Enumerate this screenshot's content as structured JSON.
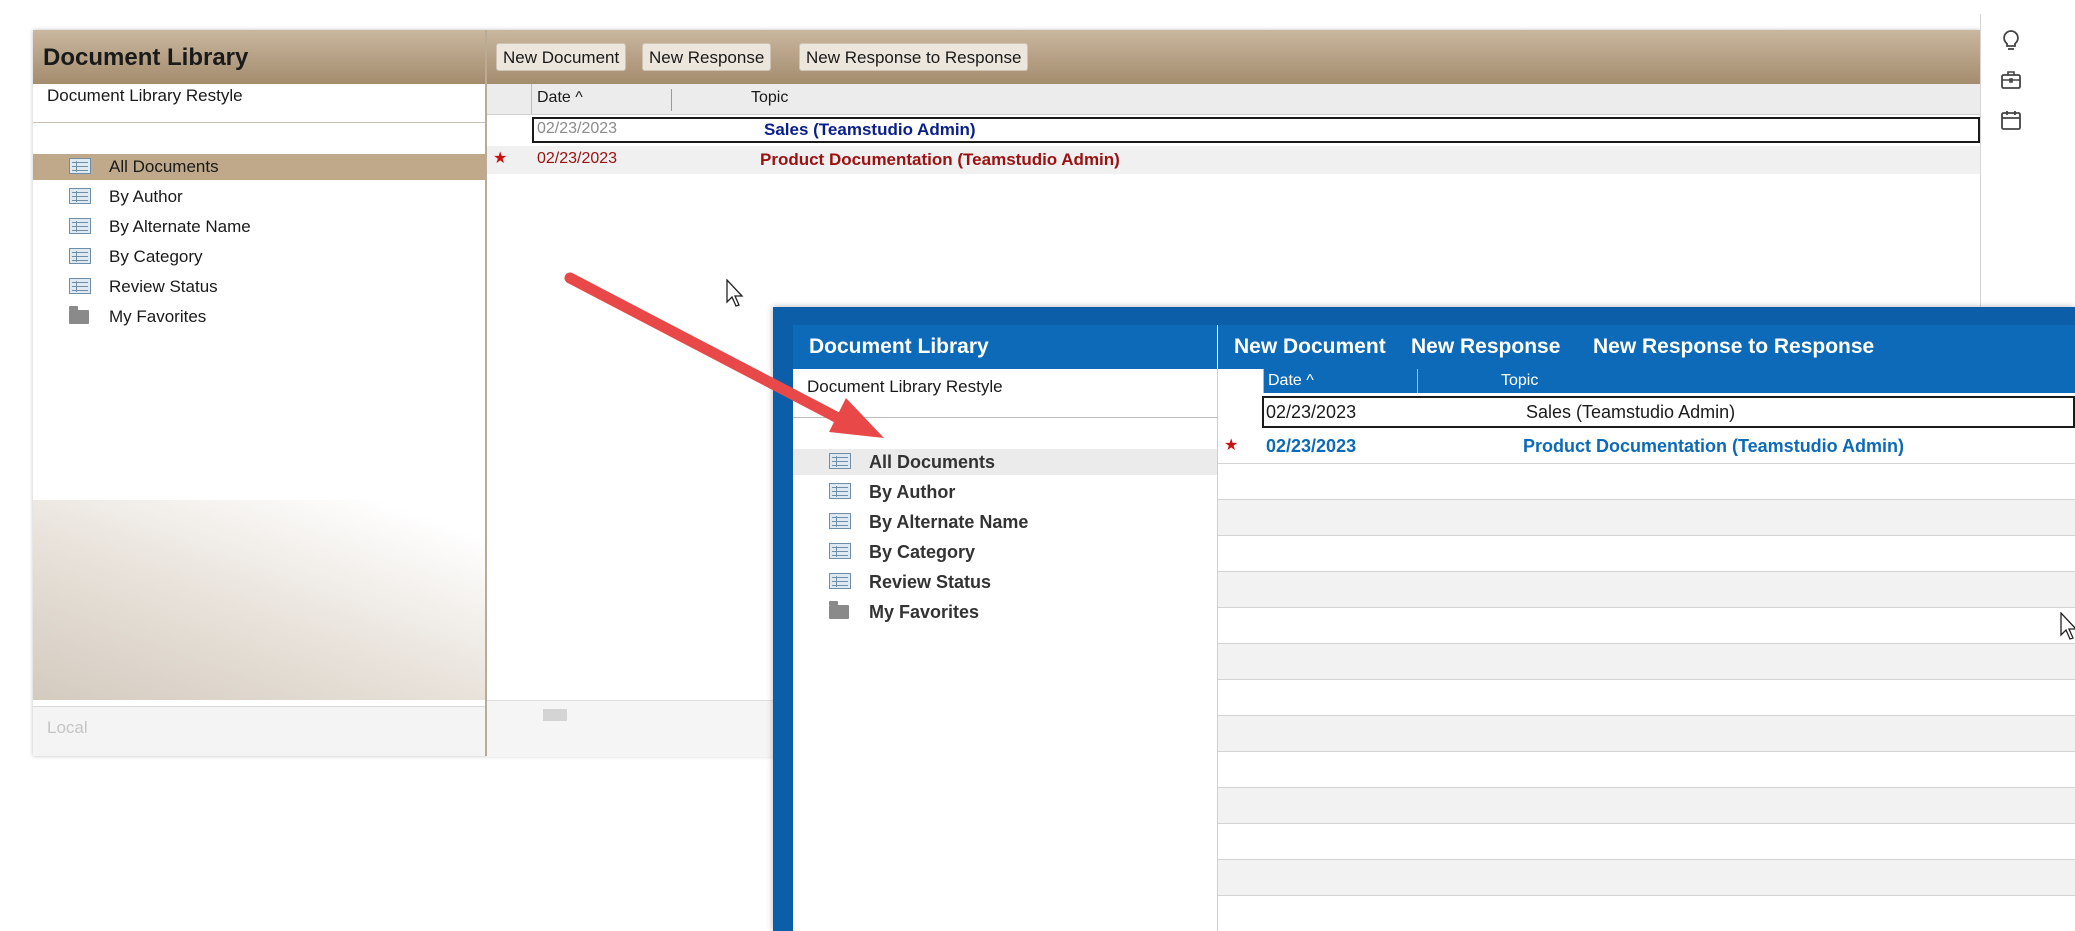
{
  "old_window": {
    "nav_title": "Document Library",
    "nav_subtitle": "Document Library Restyle",
    "nav_items": [
      {
        "label": "All Documents",
        "icon": "view-icon",
        "selected": true
      },
      {
        "label": "By Author",
        "icon": "view-icon",
        "selected": false
      },
      {
        "label": "By Alternate Name",
        "icon": "view-icon",
        "selected": false
      },
      {
        "label": "By Category",
        "icon": "view-icon",
        "selected": false
      },
      {
        "label": "Review Status",
        "icon": "view-icon",
        "selected": false
      },
      {
        "label": "My Favorites",
        "icon": "folder-icon",
        "selected": false
      }
    ],
    "footer_label": "Local",
    "actions": [
      "New Document",
      "New Response",
      "New Response to Response"
    ],
    "columns": {
      "date": "Date ^",
      "topic": "Topic"
    },
    "rows": [
      {
        "date": "02/23/2023",
        "topic": "Sales (Teamstudio Admin)",
        "unread": false,
        "selected": true
      },
      {
        "date": "02/23/2023",
        "topic": "Product Documentation (Teamstudio Admin)",
        "unread": true,
        "selected": false
      }
    ],
    "colors": {
      "header": "#a48c6e",
      "selection": "#bfa98a",
      "sales_text": "#0a1f8a",
      "doc_text": "#9b1010"
    }
  },
  "new_window": {
    "nav_title": "Document Library",
    "nav_subtitle": "Document Library Restyle",
    "nav_items": [
      {
        "label": "All Documents",
        "icon": "view-icon",
        "selected": true
      },
      {
        "label": "By Author",
        "icon": "view-icon",
        "selected": false
      },
      {
        "label": "By Alternate Name",
        "icon": "view-icon",
        "selected": false
      },
      {
        "label": "By Category",
        "icon": "view-icon",
        "selected": false
      },
      {
        "label": "Review Status",
        "icon": "view-icon",
        "selected": false
      },
      {
        "label": "My Favorites",
        "icon": "folder-icon",
        "selected": false
      }
    ],
    "actions": [
      "New Document",
      "New Response",
      "New Response to Response"
    ],
    "columns": {
      "date": "Date ^",
      "topic": "Topic"
    },
    "rows": [
      {
        "date": "02/23/2023",
        "topic": "Sales (Teamstudio Admin)",
        "unread": false,
        "selected": true
      },
      {
        "date": "02/23/2023",
        "topic": "Product Documentation (Teamstudio Admin)",
        "unread": true,
        "selected": false
      }
    ],
    "colors": {
      "header": "#0d6ab8",
      "link_text": "#0d6ab8"
    }
  },
  "sidebar_icons": [
    "lightbulb-icon",
    "briefcase-icon",
    "calendar-icon"
  ],
  "annotation": {
    "arrow_color": "#e84848"
  }
}
